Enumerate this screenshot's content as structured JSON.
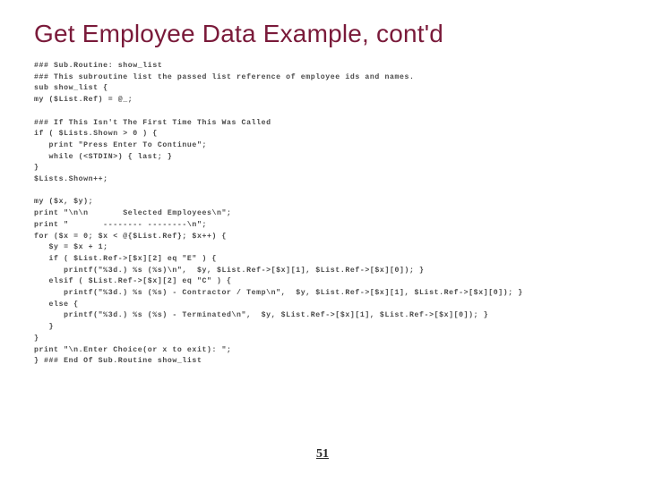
{
  "title": "Get Employee Data Example, cont'd",
  "page_number": "51",
  "code": "### Sub.Routine: show_list\n### This subroutine list the passed list reference of employee ids and names.\nsub show_list {\nmy ($List.Ref) = @_;\n\n### If This Isn't The First Time This Was Called\nif ( $Lists.Shown > 0 ) {\n   print \"Press Enter To Continue\";\n   while (<STDIN>) { last; }\n}\n$Lists.Shown++;\n\nmy ($x, $y);\nprint \"\\n\\n       Selected Employees\\n\";\nprint \"       -------- --------\\n\";\nfor ($x = 0; $x < @{$List.Ref}; $x++) {\n   $y = $x + 1;\n   if ( $List.Ref->[$x][2] eq \"E\" ) {\n      printf(\"%3d.) %s (%s)\\n\",  $y, $List.Ref->[$x][1], $List.Ref->[$x][0]); }\n   elsif ( $List.Ref->[$x][2] eq \"C\" ) {\n      printf(\"%3d.) %s (%s) - Contractor / Temp\\n\",  $y, $List.Ref->[$x][1], $List.Ref->[$x][0]); }\n   else {\n      printf(\"%3d.) %s (%s) - Terminated\\n\",  $y, $List.Ref->[$x][1], $List.Ref->[$x][0]); }\n   }\n}\nprint \"\\n.Enter Choice(or x to exit): \";\n} ### End Of Sub.Routine show_list"
}
